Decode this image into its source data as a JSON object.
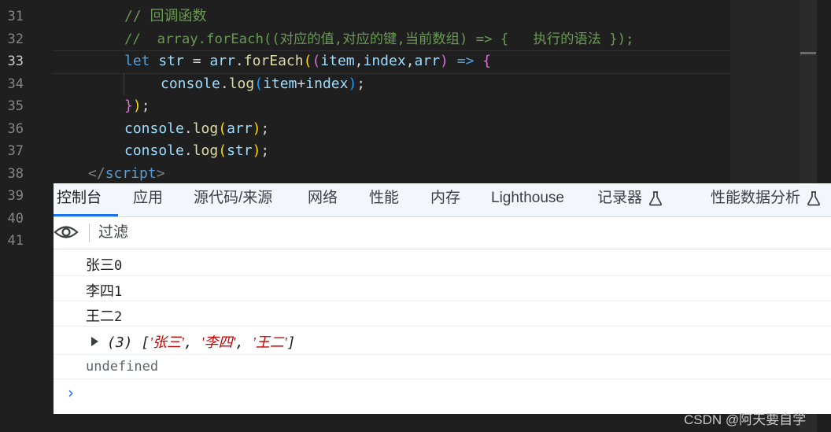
{
  "editor": {
    "line_numbers": [
      "31",
      "32",
      "33",
      "34",
      "35",
      "36",
      "37",
      "38",
      "39",
      "40",
      "41"
    ],
    "active_line": "33",
    "line31": "// 回调函数",
    "line32": "//  array.forEach((对应的值,对应的键,当前数组) => {   执行的语法 });",
    "line33": {
      "kw": "let",
      "var": "str",
      "eq": " = ",
      "obj": "arr",
      "dot": ".",
      "fn": "forEach",
      "paren1": "(",
      "paren2": "(",
      "p1": "item",
      "comma1": ",",
      "p2": "index",
      "comma2": ",",
      "p3": "arr",
      "paren3": ")",
      "arrow": " => ",
      "brace": "{"
    },
    "line34": {
      "obj": "console",
      "dot": ".",
      "fn": "log",
      "open": "(",
      "a": "item",
      "plus": "+",
      "b": "index",
      "close": ")",
      "semi": ";"
    },
    "line35": {
      "brace": "}",
      "paren": ")",
      "semi": ";"
    },
    "line36": {
      "obj": "console",
      "dot": ".",
      "fn": "log",
      "open": "(",
      "arg": "arr",
      "close": ")",
      "semi": ";"
    },
    "line37": {
      "obj": "console",
      "dot": ".",
      "fn": "log",
      "open": "(",
      "arg": "str",
      "close": ")",
      "semi": ";"
    },
    "line38": {
      "open": "</",
      "tag": "script",
      "close": ">"
    }
  },
  "devtools": {
    "tabs": [
      "控制台",
      "应用",
      "源代码/来源",
      "网络",
      "性能",
      "内存",
      "Lighthouse",
      "记录器",
      "性能数据分析"
    ],
    "active_tab": "控制台",
    "filter_placeholder": "过滤",
    "logs": [
      {
        "text": "张三",
        "num": "0"
      },
      {
        "text": "李四",
        "num": "1"
      },
      {
        "text": "王二",
        "num": "2"
      }
    ],
    "array_log": {
      "count": "(3)",
      "open": "[",
      "items": [
        "'张三'",
        "'李四'",
        "'王二'"
      ],
      "sep": ", ",
      "close": "]"
    },
    "undefined_text": "undefined",
    "prompt": "›"
  },
  "watermark": "CSDN @阿天要自学",
  "colors": {
    "editor_bg": "#1f1f1f",
    "comment": "#6a9955",
    "keyword": "#569cd6",
    "variable": "#9cdcfe",
    "function": "#dcdcaa",
    "accent": "#1a73e8",
    "string": "#c80000"
  },
  "icons": [
    "eye-icon",
    "flask-icon",
    "expand-triangle-icon",
    "prompt-chevron-icon"
  ]
}
